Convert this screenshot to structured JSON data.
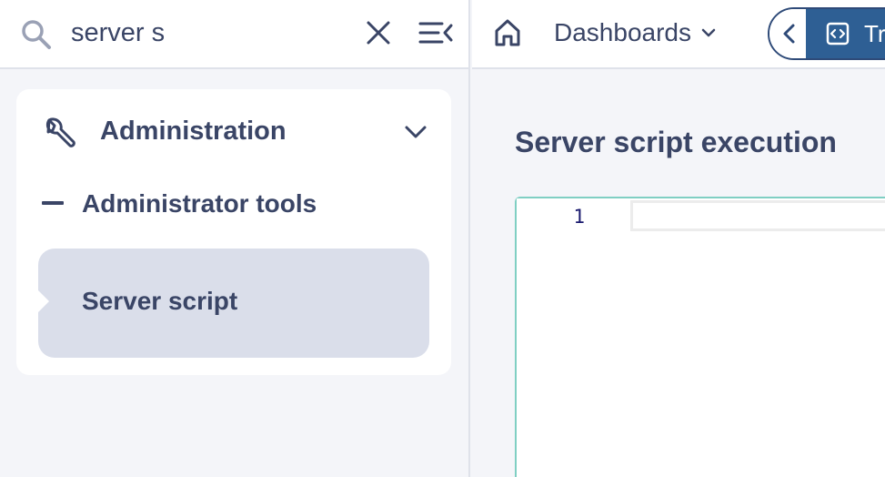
{
  "search": {
    "value": "server s"
  },
  "sidebar": {
    "section": {
      "label": "Administration"
    },
    "subgroup": {
      "label": "Administrator tools"
    },
    "active_item": {
      "label": "Server script"
    }
  },
  "topbar": {
    "dashboards_label": "Dashboards",
    "tab_label": "Tr"
  },
  "main": {
    "title": "Server script execution",
    "editor": {
      "line_numbers": [
        "1"
      ]
    }
  },
  "colors": {
    "primary_text": "#3a4566",
    "accent_blue": "#2e5f94",
    "active_item_bg": "#dadeea",
    "editor_border": "#7fcfc3"
  }
}
